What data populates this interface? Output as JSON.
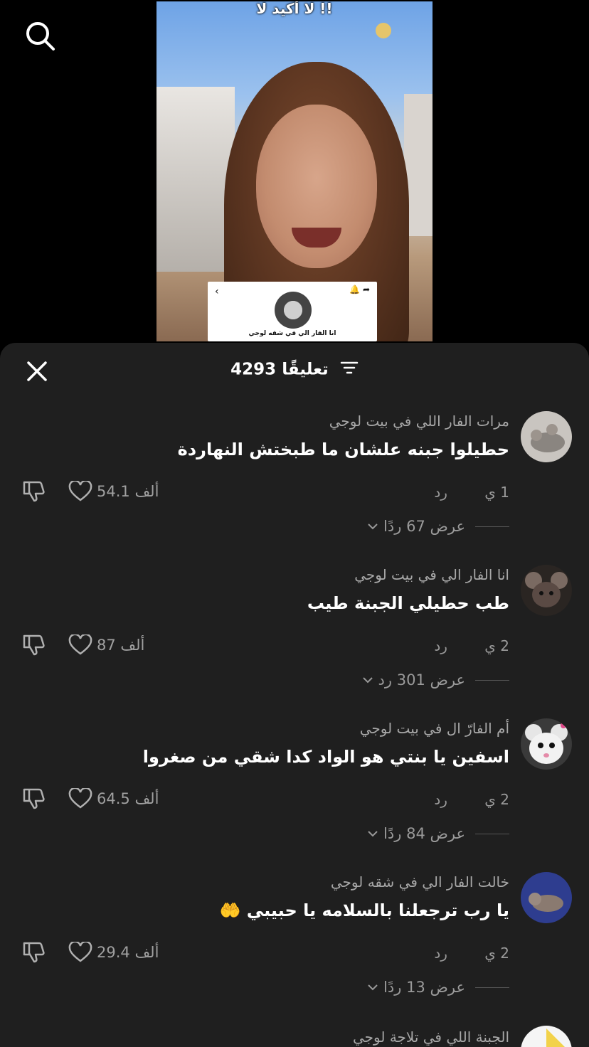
{
  "video": {
    "overlay_caption": "لا أكيد لا !!",
    "card_name": "انا الفار الي في شقه لوجي"
  },
  "sheet": {
    "title": "4293 تعليقًا"
  },
  "comments": [
    {
      "username": "مرات الفار اللي في بيت لوجي",
      "text": "حطيلوا جبنه علشان ما طبختش النهاردة",
      "time": "1 ي",
      "reply_label": "رد",
      "likes": "54.1 ألف",
      "view_replies": "عرض 67 ردًا",
      "avatar_color": "#8a8580"
    },
    {
      "username": "انا الفار الي في بيت لوجي",
      "text": "طب حطيلي الجبنة طيب",
      "time": "2 ي",
      "reply_label": "رد",
      "likes": "87 ألف",
      "view_replies": "عرض 301 رد",
      "avatar_color": "#5a4a44"
    },
    {
      "username": "أم الفارّ ال في بيت لوجي",
      "text": "اسفين يا بنتي هو الواد كدا شقي من صغروا",
      "time": "2 ي",
      "reply_label": "رد",
      "likes": "64.5 ألف",
      "view_replies": "عرض 84 ردًا",
      "avatar_color": "#e6e6e6"
    },
    {
      "username": "خالت الفار الي في شقه لوجي",
      "text": "يا رب ترجعلنا بالسلامه يا حبيبي 🤲",
      "time": "2 ي",
      "reply_label": "رد",
      "likes": "29.4 ألف",
      "view_replies": "عرض 13 ردًا",
      "avatar_color": "#2e3d8f"
    },
    {
      "username": "الجبنة اللي في تلاجة لوجي",
      "avatar_color": "#f2d24a"
    }
  ]
}
